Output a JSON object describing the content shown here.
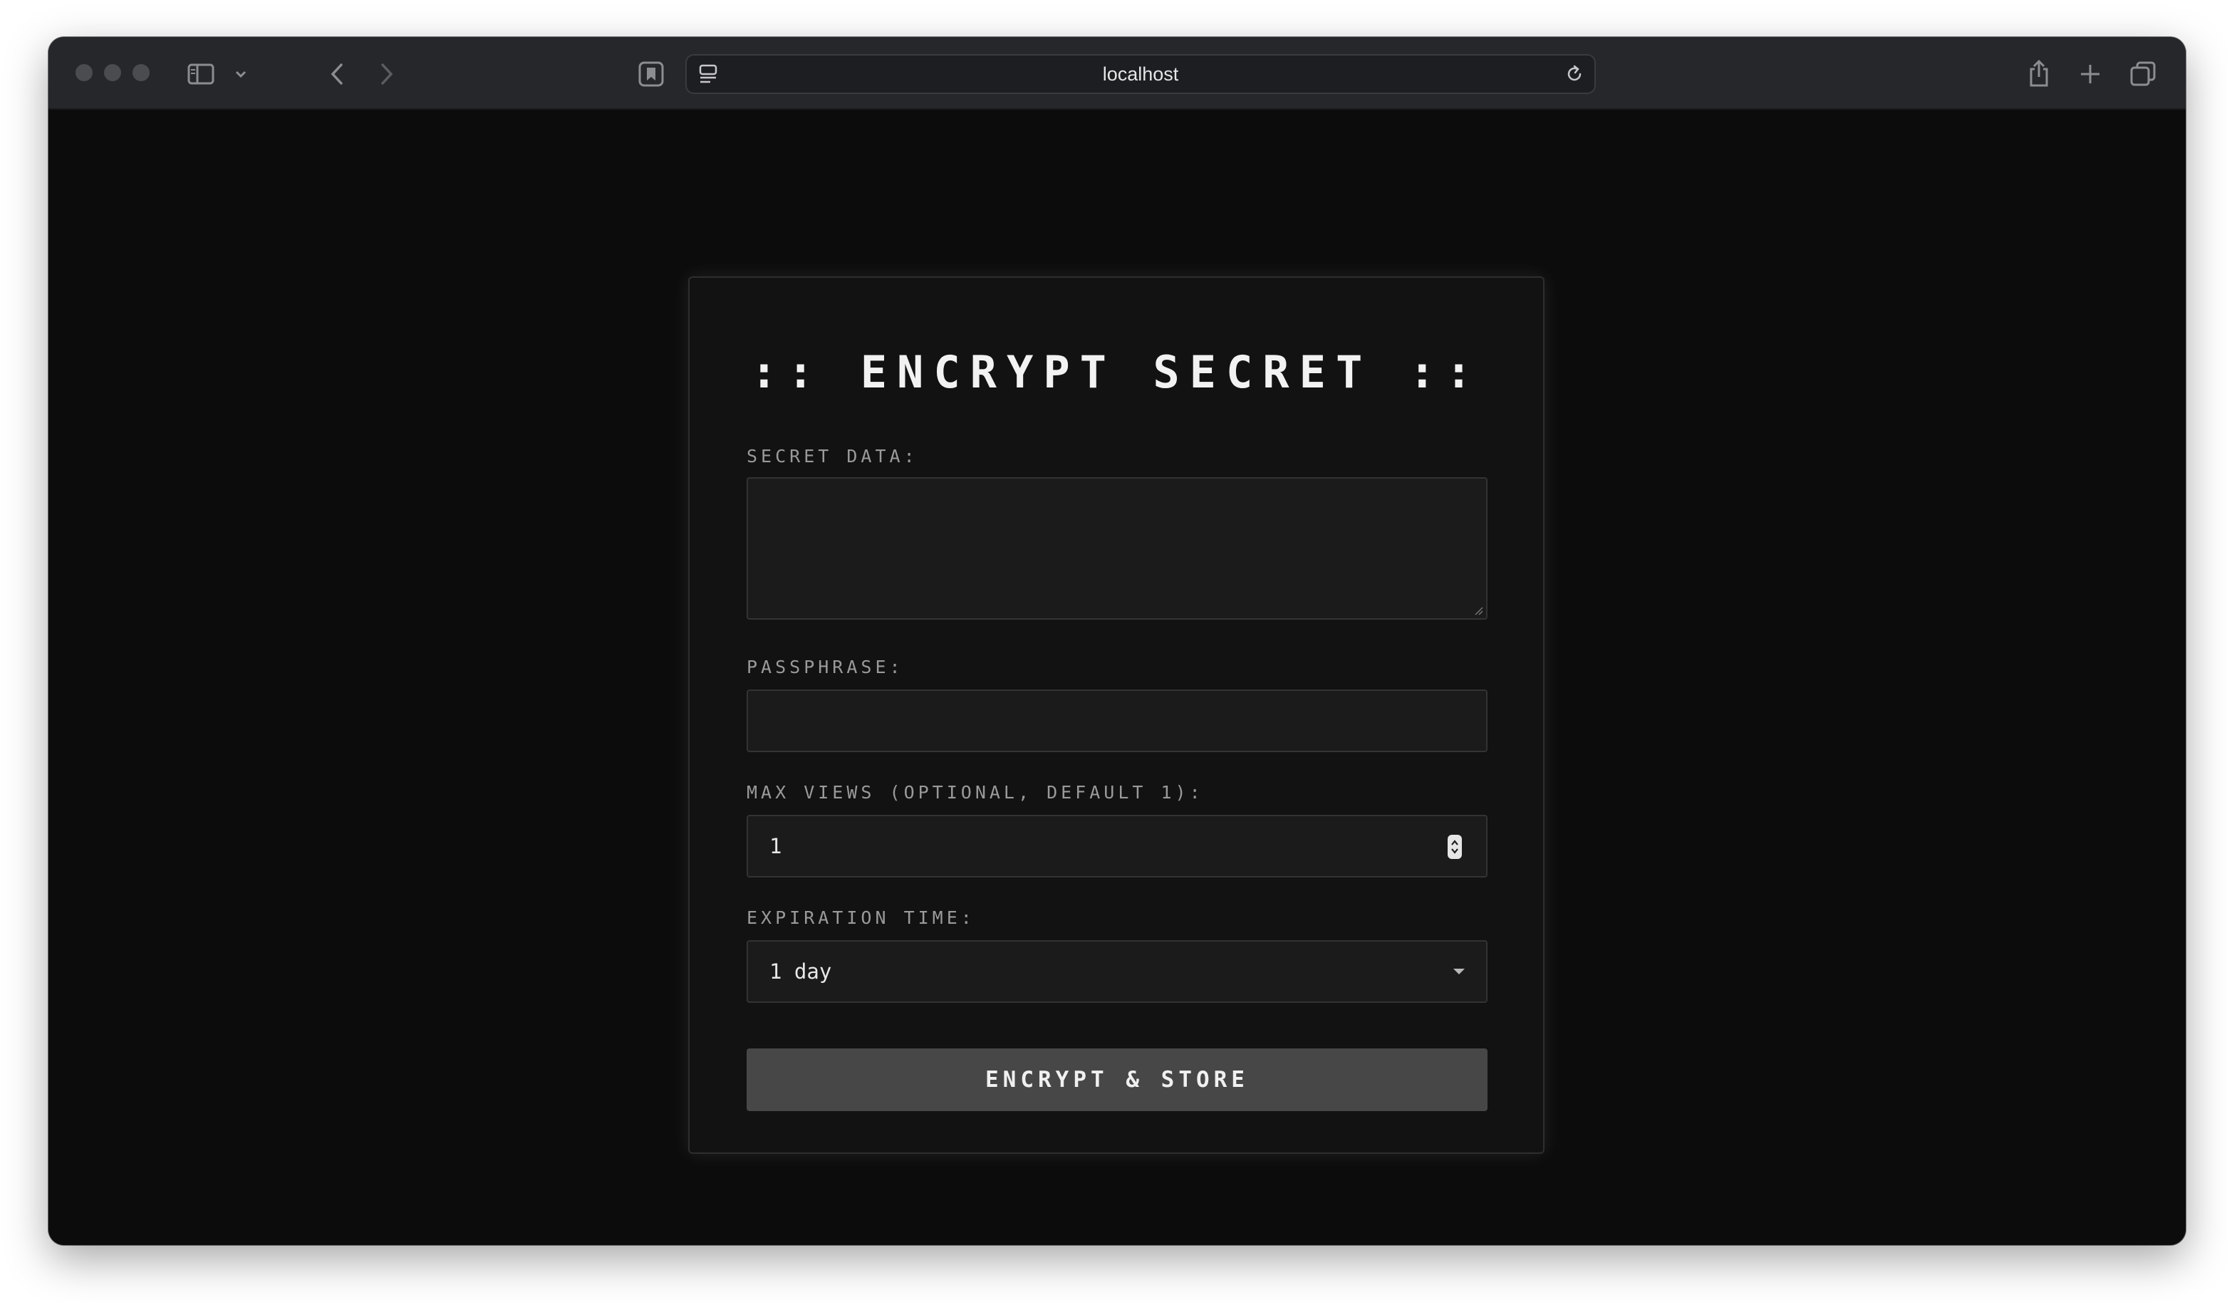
{
  "browser": {
    "url": "localhost",
    "icons": {
      "sidebar": "sidebar-icon",
      "chevron": "chevron-down-icon",
      "back": "back-arrow-icon",
      "forward": "forward-arrow-icon",
      "bookmark": "bookmark-icon",
      "site_settings": "page-settings-icon",
      "reload": "reload-icon",
      "share": "share-icon",
      "new_tab": "plus-icon",
      "tabs": "tab-overview-icon"
    }
  },
  "form": {
    "title": ":: ENCRYPT SECRET ::",
    "secret_label": "SECRET DATA:",
    "secret_value": "",
    "passphrase_label": "PASSPHRASE:",
    "passphrase_value": "",
    "max_views_label": "MAX VIEWS (OPTIONAL, DEFAULT 1):",
    "max_views_value": "1",
    "expiration_label": "EXPIRATION TIME:",
    "expiration_value": "1 day",
    "submit_label": "ENCRYPT & STORE"
  },
  "colors": {
    "background": "#0c0c0c",
    "card": "#121212",
    "field": "#1b1b1b",
    "button": "#474747",
    "text": "#f2f2f2",
    "label": "#9a9a9a"
  }
}
